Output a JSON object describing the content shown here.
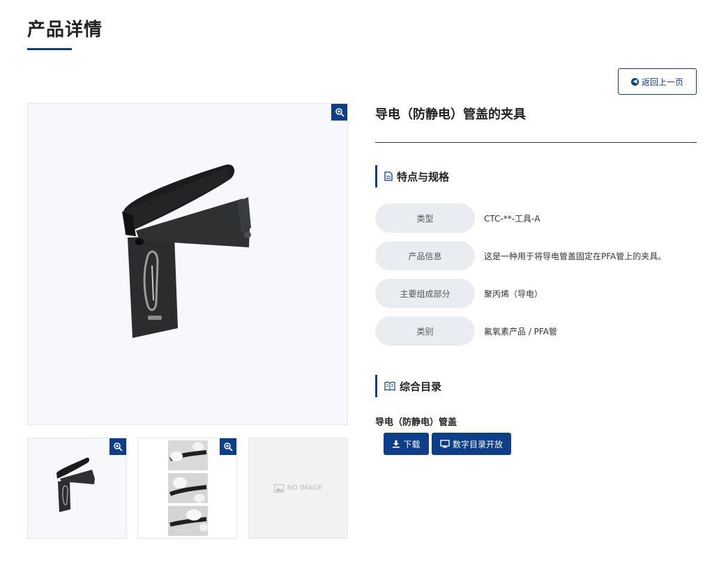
{
  "page": {
    "title": "产品详情"
  },
  "toolbar": {
    "back_label": "返回上一页"
  },
  "product": {
    "name": "导电（防静电）管盖的夹具"
  },
  "specs": {
    "heading": "特点与规格",
    "rows": [
      {
        "label": "类型",
        "value": "CTC-**-工具-A"
      },
      {
        "label": "产品信息",
        "value": "这是一种用于将导电管盖固定在PFA管上的夹具。"
      },
      {
        "label": "主要组成部分",
        "value": "聚丙烯（导电）"
      },
      {
        "label": "类别",
        "value": "氟氧素产品 / PFA管"
      }
    ]
  },
  "catalog": {
    "heading": "综合目录",
    "item_title": "导电（防静电）管盖",
    "download_label": "下载",
    "digital_label": "数字目录开放"
  },
  "gallery": {
    "no_image_label": "NO IMAGE"
  },
  "icons": {
    "back": "arrow-circle-left-icon",
    "zoom": "zoom-in-icon",
    "spec": "document-icon",
    "catalog": "book-icon",
    "download": "download-icon",
    "digital": "monitor-icon",
    "placeholder": "image-icon"
  },
  "colors": {
    "accent": "#0d3e8a",
    "label_bg": "#e9ecf0",
    "image_bg": "#f6f8fc"
  }
}
